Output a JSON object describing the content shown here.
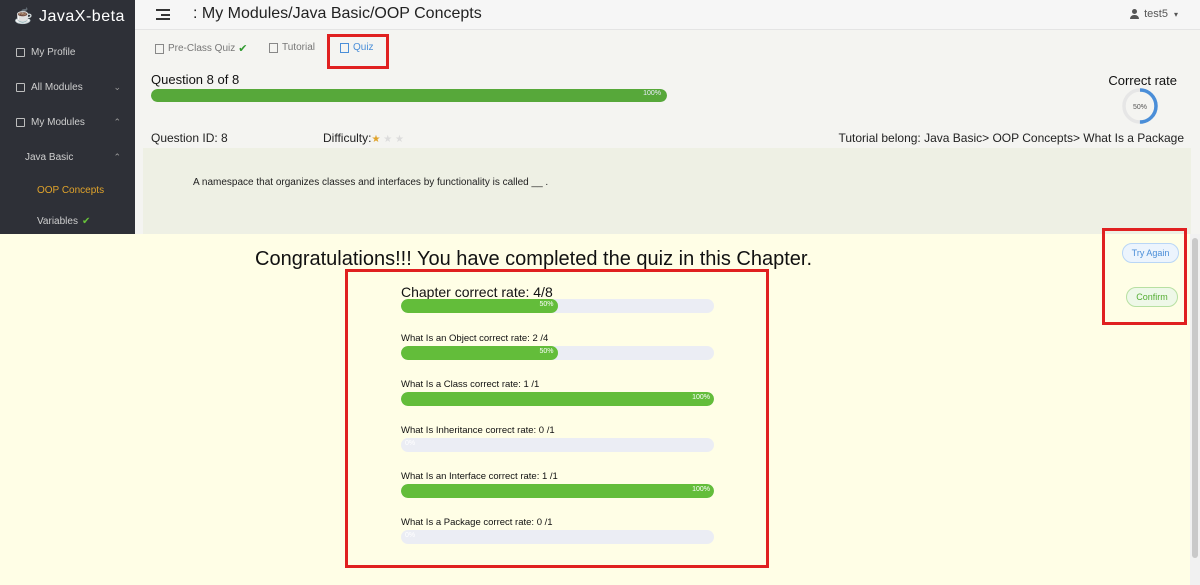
{
  "app": {
    "title": "JavaX-beta"
  },
  "sidebar": {
    "items": [
      {
        "label": "My Profile"
      },
      {
        "label": "All Modules"
      },
      {
        "label": "My Modules"
      }
    ],
    "module": "Java Basic",
    "subitems": [
      {
        "label": "OOP Concepts",
        "active": true
      },
      {
        "label": "Variables",
        "completed": true
      }
    ]
  },
  "header": {
    "breadcrumb": ": My Modules/Java Basic/OOP Concepts",
    "user": "test5"
  },
  "tabs": [
    {
      "label": "Pre-Class Quiz",
      "completed": true
    },
    {
      "label": "Tutorial"
    },
    {
      "label": "Quiz",
      "active": true
    }
  ],
  "quiz": {
    "title": "Question 8 of 8",
    "progress_percent": 100,
    "progress_label": "100%",
    "correct_rate_label": "Correct rate",
    "correct_rate_percent": 50,
    "correct_rate_text": "50%",
    "question_id": "Question ID: 8",
    "difficulty_label": "Difficulty:",
    "difficulty_stars": 1,
    "difficulty_max": 3,
    "tutorial_belong": "Tutorial belong:  Java Basic> OOP Concepts> What Is a Package",
    "question_text": "A namespace that organizes classes and interfaces by functionality is called __ ."
  },
  "result": {
    "congrats": "Congratulations!!!  You have completed the quiz in this Chapter.",
    "chapter": {
      "label": "Chapter correct rate: 4/8",
      "percent": 50,
      "percent_text": "50%"
    },
    "rows": [
      {
        "label": "What Is an Object correct rate:  2 /4",
        "percent": 50,
        "percent_text": "50%"
      },
      {
        "label": "What Is a Class correct rate:  1 /1",
        "percent": 100,
        "percent_text": "100%"
      },
      {
        "label": "What Is Inheritance correct rate:  0 /1",
        "percent": 0,
        "percent_text": "0%"
      },
      {
        "label": "What Is an Interface correct rate:  1 /1",
        "percent": 100,
        "percent_text": "100%"
      },
      {
        "label": "What Is a Package correct rate:  0 /1",
        "percent": 0,
        "percent_text": "0%"
      }
    ],
    "buttons": {
      "try_again": "Try Again",
      "confirm": "Confirm"
    }
  },
  "colors": {
    "sidebar_bg": "#2e3037",
    "accent_green": "#63bd3a",
    "accent_blue": "#4a8ed8",
    "active_orange": "#e0a32b",
    "highlight_red": "#e02020"
  }
}
